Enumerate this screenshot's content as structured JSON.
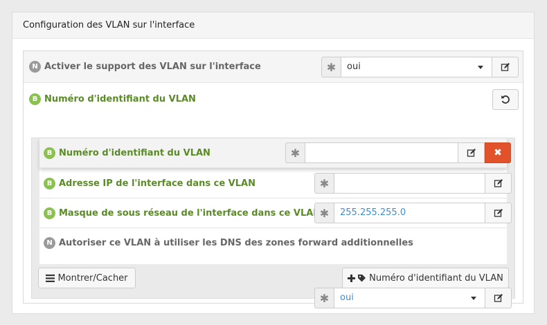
{
  "panel": {
    "title": "Configuration des VLAN sur l'interface"
  },
  "row_activer": {
    "badge": "N",
    "label": "Activer le support des VLAN sur l'interface",
    "addon": "✱",
    "value": "oui"
  },
  "row_numero": {
    "badge": "B",
    "label": "Numéro d'identifiant du VLAN"
  },
  "inner": {
    "numero": {
      "badge": "B",
      "label": "Numéro d'identifiant du VLAN",
      "addon": "✱",
      "value": "",
      "remove": "✖"
    },
    "adresse": {
      "badge": "B",
      "label": "Adresse IP de l'interface dans ce VLAN",
      "addon": "✱",
      "value": ""
    },
    "masque": {
      "badge": "B",
      "label": "Masque de sous réseau de l'interface dans ce VLAN",
      "addon": "✱",
      "value": "255.255.255.0"
    },
    "dns": {
      "badge": "N",
      "label": "Autoriser ce VLAN à utiliser les DNS des zones forward additionnelles",
      "addon": "✱",
      "value": "oui"
    }
  },
  "buttons": {
    "toggle": "Montrer/Cacher",
    "add": "Numéro d'identifiant du VLAN"
  },
  "colors": {
    "accent_green": "#5a8b26",
    "badge_green": "#8cc152",
    "danger": "#e1522a",
    "link_blue": "#3a8ed6"
  }
}
